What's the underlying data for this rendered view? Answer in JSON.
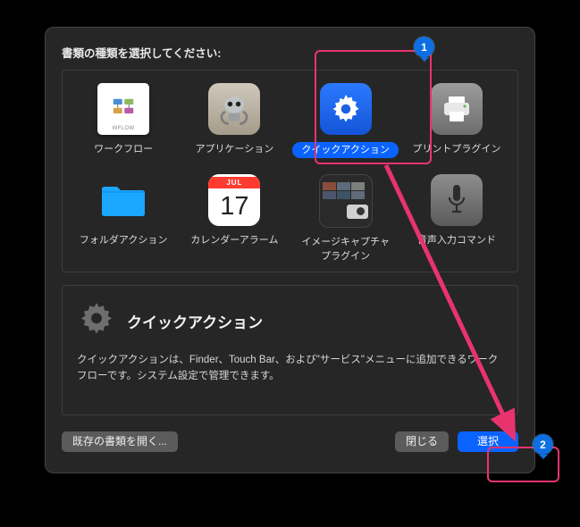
{
  "dialog": {
    "title": "書類の種類を選択してください:"
  },
  "types": [
    {
      "label": "ワークフロー"
    },
    {
      "label": "アプリケーション"
    },
    {
      "label": "クイックアクション",
      "selected": true
    },
    {
      "label": "プリントプラグイン"
    },
    {
      "label": "フォルダアクション"
    },
    {
      "label": "カレンダーアラーム"
    },
    {
      "label": "イメージキャプチャ\nプラグイン"
    },
    {
      "label": "音声入力コマンド"
    }
  ],
  "calendar": {
    "month": "JUL",
    "day": "17"
  },
  "description": {
    "title": "クイックアクション",
    "body": "クイックアクションは、Finder、Touch Bar、および\"サービス\"メニューに追加できるワークフローです。システム設定で管理できます。"
  },
  "footer": {
    "open_existing": "既存の書類を開く...",
    "close": "閉じる",
    "choose": "選択"
  },
  "annotation": {
    "step1": "1",
    "step2": "2"
  }
}
